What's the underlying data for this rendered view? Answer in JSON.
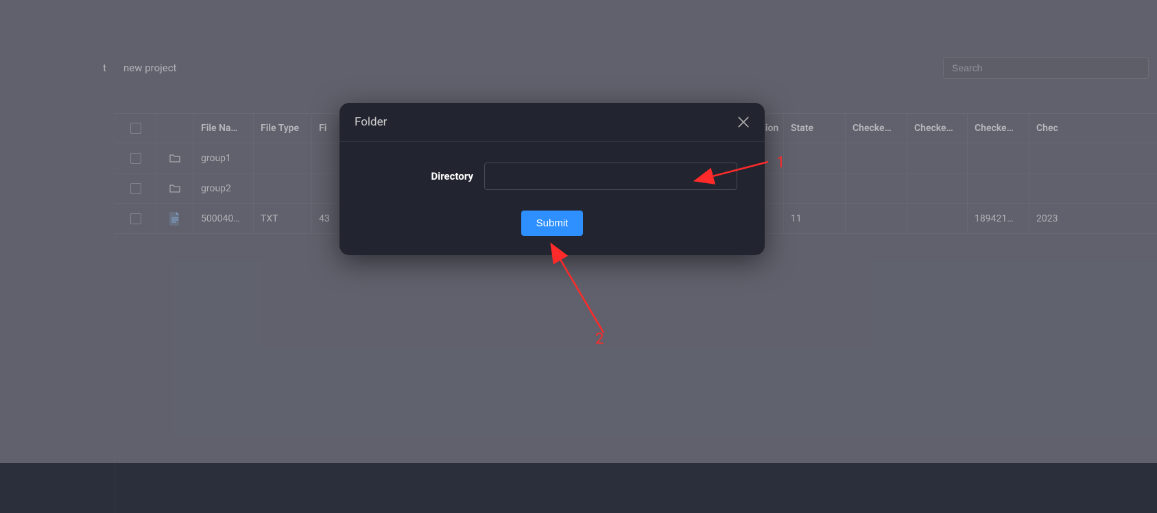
{
  "sidebar": {
    "item_label": "t"
  },
  "breadcrumb": "new project",
  "search": {
    "placeholder": "Search"
  },
  "table": {
    "headers": {
      "name": "File Na…",
      "type": "File Type",
      "fi": "Fi",
      "ision": "ision",
      "state": "State",
      "checke1": "Checke…",
      "checke2": "Checke…",
      "checke3": "Checke…",
      "chec": "Chec"
    },
    "rows": [
      {
        "kind": "folder",
        "name": "group1",
        "type": "",
        "fi": "",
        "ision": "",
        "state": "",
        "c1": "",
        "c2": "",
        "c3": "",
        "c4": ""
      },
      {
        "kind": "folder",
        "name": "group2",
        "type": "",
        "fi": "",
        "ision": "",
        "state": "",
        "c1": "",
        "c2": "",
        "c3": "",
        "c4": ""
      },
      {
        "kind": "file",
        "name": "500040…",
        "type": "TXT",
        "fi": "43",
        "ision": "",
        "state": "11",
        "c1": "",
        "c2": "",
        "c3": "189421…",
        "c4": "2023"
      }
    ]
  },
  "modal": {
    "title": "Folder",
    "field_label": "Directory",
    "submit": "Submit"
  },
  "annotations": {
    "a1": "1",
    "a2": "2"
  }
}
